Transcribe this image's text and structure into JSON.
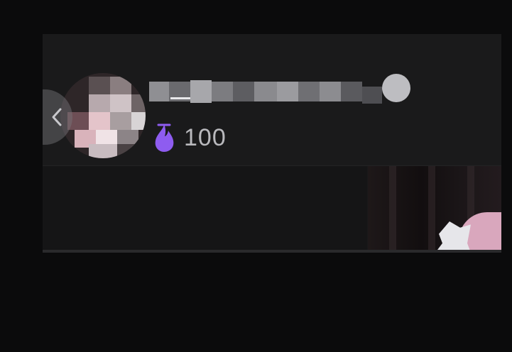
{
  "profile": {
    "hot_value": "100"
  },
  "colors": {
    "background": "#0b0b0c",
    "card": "#1a1a1b",
    "flame": "#8e5cf0",
    "text": "#b9b9bd"
  },
  "icons": {
    "back": "chevron-left-icon",
    "hot": "flame-icon"
  }
}
